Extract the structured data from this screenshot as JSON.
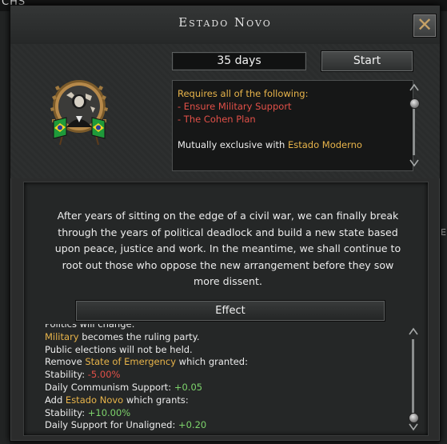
{
  "background": {
    "top_cut_text": "CHS",
    "right_cut_text": "Er"
  },
  "window": {
    "title": "Estado Novo",
    "close_icon": "close-x-icon",
    "duration": "35 days",
    "start_label": "Start"
  },
  "requirements": {
    "heading": "Requires all of the following:",
    "items": [
      "- Ensure Military Support",
      "- The Cohen Plan"
    ],
    "exclusive_prefix": "Mutually exclusive with",
    "exclusive_focus": "Estado Moderno"
  },
  "description": "After years of sitting on the edge of a civil war, we can finally break through the years of political deadlock and build a new state based upon peace, justice and work. In the meantime, we shall continue to root out those who oppose the new arrangement before they sow more dissent.",
  "effect": {
    "header": "Effect",
    "lines": [
      {
        "parts": [
          {
            "t": "Politics will change:",
            "c": "white"
          }
        ]
      },
      {
        "parts": [
          {
            "t": "Military",
            "c": "gold"
          },
          {
            "t": " becomes the ruling party.",
            "c": "white"
          }
        ]
      },
      {
        "parts": [
          {
            "t": "Public elections will not be held.",
            "c": "white"
          }
        ]
      },
      {
        "parts": [
          {
            "t": "Remove ",
            "c": "white"
          },
          {
            "t": "State of Emergency",
            "c": "gold"
          },
          {
            "t": " which granted:",
            "c": "white"
          }
        ]
      },
      {
        "parts": [
          {
            "t": "Stability: ",
            "c": "white"
          },
          {
            "t": "-5.00%",
            "c": "red"
          }
        ]
      },
      {
        "parts": [
          {
            "t": "Daily Communism Support: ",
            "c": "white"
          },
          {
            "t": "+0.05",
            "c": "green"
          }
        ]
      },
      {
        "parts": [
          {
            "t": "Add ",
            "c": "white"
          },
          {
            "t": "Estado Novo",
            "c": "gold"
          },
          {
            "t": " which grants:",
            "c": "white"
          }
        ]
      },
      {
        "parts": [
          {
            "t": "Stability: ",
            "c": "white"
          },
          {
            "t": "+10.00%",
            "c": "green"
          }
        ]
      },
      {
        "parts": [
          {
            "t": "Daily Support for Unaligned: ",
            "c": "white"
          },
          {
            "t": "+0.20",
            "c": "green"
          }
        ]
      }
    ]
  },
  "colors": {
    "gold": "#e8b44a",
    "red": "#e25048",
    "green": "#7dd36b",
    "text": "#ececec"
  }
}
